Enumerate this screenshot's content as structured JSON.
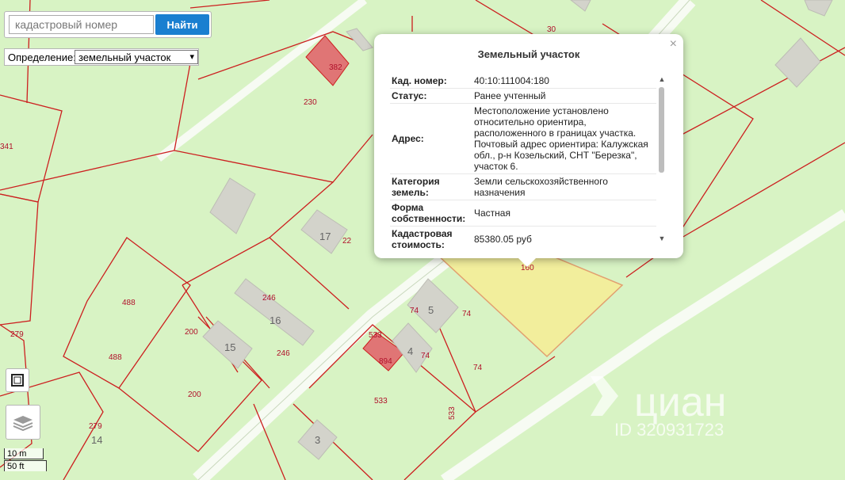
{
  "search": {
    "placeholder": "кадастровый номер",
    "button_label": "Найти"
  },
  "definition": {
    "label": "Определение:",
    "selected": "земельный участок"
  },
  "scale": {
    "metric": "10 m",
    "imperial": "50 ft"
  },
  "popup": {
    "title": "Земельный участок",
    "close": "×",
    "rows": [
      {
        "key": "Кад. номер:",
        "value": "40:10:111004:180"
      },
      {
        "key": "Статус:",
        "value": "Ранее учтенный"
      },
      {
        "key": "Адрес:",
        "value": "Местоположение установлено относительно ориентира, расположенного в границах участка. Почтовый адрес ориентира: Калужская обл., р-н Козельский, СНТ \"Березка\", участок 6."
      },
      {
        "key": "Категория земель:",
        "value": "Земли сельскохозяйственного назначения"
      },
      {
        "key": "Форма собственности:",
        "value": "Частная"
      },
      {
        "key": "Кадастровая стоимость:",
        "value": "85380.05 руб"
      }
    ]
  },
  "map": {
    "colors": {
      "background": "#d8f3c4",
      "boundary": "#cc1f1f",
      "selected_fill": "#f2ee9c",
      "highlight_fill": "#e07070",
      "building": "#d8d8d0",
      "road": "#ffffff"
    },
    "parcel_labels": [
      "30",
      "382",
      "230",
      "341",
      "22",
      "160",
      "246",
      "488",
      "488",
      "200",
      "200",
      "246",
      "279",
      "279",
      "533",
      "533",
      "74",
      "74",
      "74",
      "74",
      "894"
    ],
    "house_numbers": [
      "17",
      "16",
      "15",
      "5",
      "4",
      "3",
      "14"
    ]
  },
  "watermark": {
    "brand": "циан",
    "id_text": "ID 320931723"
  }
}
